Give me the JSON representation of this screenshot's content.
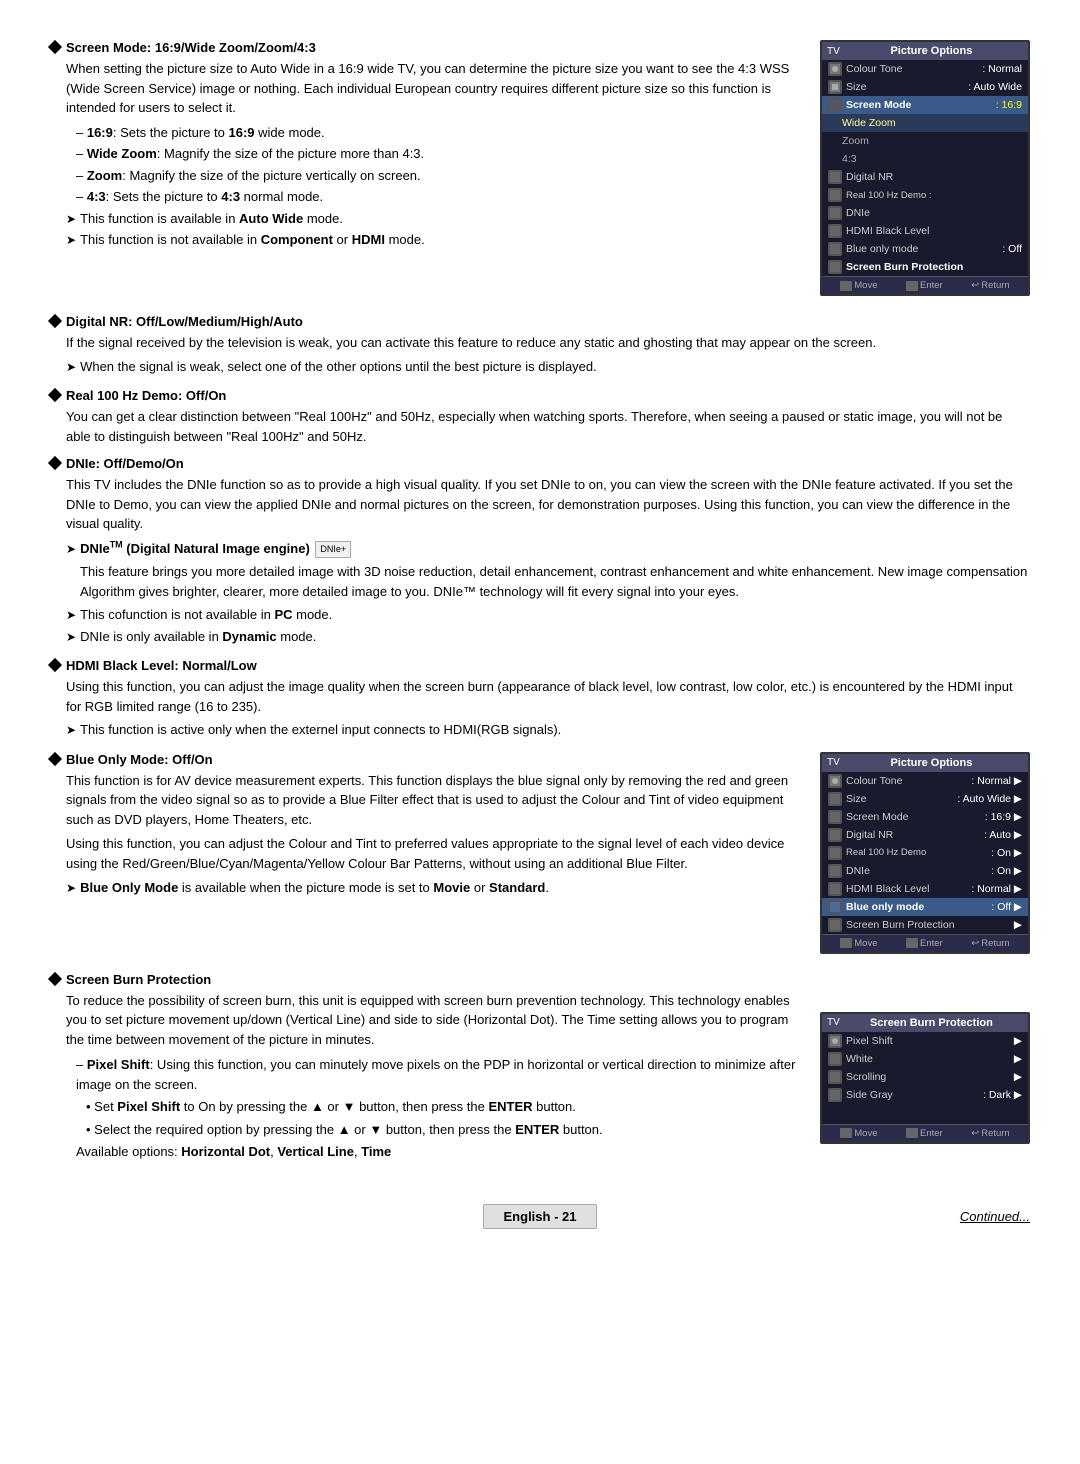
{
  "page": {
    "sections": [
      {
        "id": "screen-mode",
        "heading": "Screen Mode: 16:9/Wide Zoom/Zoom/4:3",
        "paragraphs": [
          "When setting the picture size to Auto Wide in a 16:9 wide TV, you can determine the picture size you want to see the 4:3 WSS (Wide Screen Service) image or nothing. Each individual European country requires different picture size so this function is intended for users to select it."
        ],
        "bullets": [
          "– 16:9: Sets the picture to 16:9 wide mode.",
          "– Wide Zoom: Magnify the size of the picture more than 4:3.",
          "– Zoom: Magnify the size of the picture vertically on screen.",
          "– 4:3: Sets the picture to 4:3 normal mode."
        ],
        "arrows": [
          "This function is available in Auto Wide mode.",
          "This function is not available in Component or HDMI mode."
        ],
        "has_tv": true
      },
      {
        "id": "digital-nr",
        "heading": "Digital NR: Off/Low/Medium/High/Auto",
        "paragraphs": [
          "If the signal received by the television is weak, you can activate this feature to reduce any static and ghosting that may appear on the screen."
        ],
        "arrows": [
          "When the signal is weak, select one of the other options until the best picture is displayed."
        ]
      },
      {
        "id": "real-100hz",
        "heading": "Real 100 Hz Demo: Off/On",
        "paragraphs": [
          "You can get a clear distinction between \"Real 100Hz\" and 50Hz, especially when watching sports. Therefore, when seeing a paused or static image, you will not be able to distinguish between \"Real 100Hz\" and 50Hz."
        ]
      },
      {
        "id": "dnie",
        "heading": "DNIe: Off/Demo/On",
        "paragraphs": [
          "This TV includes the DNIe function so as to provide a high visual quality. If you set DNIe to on, you can view the screen with the DNIe feature activated. If you set the DNIe to Demo, you can view the applied DNIe and normal pictures on the screen, for demonstration purposes. Using this function, you can view the difference in the visual quality."
        ],
        "sub_heading": "DNIe™ (Digital Natural Image engine)",
        "sub_heading_badge": "DNIe",
        "sub_paragraphs": [
          "This feature brings you more detailed image with 3D noise reduction, detail enhancement, contrast enhancement and white enhancement. New image compensation Algorithm gives brighter, clearer, more detailed image to you. DNIe™ technology will fit every signal into your eyes."
        ],
        "sub_arrows": [
          "This cofunction is not available in PC mode.",
          "DNIe is only available in Dynamic mode."
        ]
      },
      {
        "id": "hdmi-black",
        "heading": "HDMI Black Level: Normal/Low",
        "paragraphs": [
          "Using this function, you can adjust the image quality when the screen burn (appearance of black level, low contrast, low color, etc.) is encountered by the HDMI input for RGB limited range (16 to 235)."
        ],
        "arrows": [
          "This function is active only when the externel input connects to HDMI(RGB signals)."
        ]
      },
      {
        "id": "blue-only",
        "heading": "Blue Only Mode: Off/On",
        "paragraphs": [
          "This function is for AV device measurement experts. This function displays the blue signal only by removing the red and green signals from the video signal so as to provide a Blue Filter effect that is used to adjust the Colour and Tint of video equipment such as DVD players, Home Theaters, etc.",
          "Using this function, you can adjust the Colour and Tint to preferred values appropriate to the signal level of each video device using the Red/Green/Blue/Cyan/Magenta/Yellow Colour Bar Patterns, without using an additional Blue Filter."
        ],
        "arrows": [
          "Blue Only Mode is available when the picture mode is set to Movie or Standard."
        ],
        "has_tv2": true
      },
      {
        "id": "screen-burn",
        "heading": "Screen Burn Protection",
        "paragraphs": [
          "To reduce the possibility of screen burn, this unit is equipped with screen burn prevention technology. This technology enables you to set picture movement up/down (Vertical Line) and side to side (Horizontal Dot). The Time setting allows you to program the time between movement of the picture in minutes."
        ],
        "sub_bullets": [
          "– Pixel Shift: Using this function, you can minutely move pixels on the PDP in horizontal or vertical direction to minimize after image on the screen.",
          "• Set Pixel Shift to On by pressing the ▲ or ▼ button, then press the ENTER button.",
          "• Select the required option by pressing the ▲ or ▼ button, then press the ENTER button.",
          "Available options: Horizontal Dot, Vertical Line, Time"
        ],
        "has_tv3": true
      }
    ],
    "tv_panel_1": {
      "title_tv": "TV",
      "title_options": "Picture Options",
      "items": [
        {
          "icon": "pic",
          "label": "Colour Tone",
          "value": ": Normal",
          "highlighted": false
        },
        {
          "icon": "size",
          "label": "Size",
          "value": ": Auto Wide",
          "highlighted": false
        },
        {
          "icon": "screen",
          "label": "Screen Mode",
          "value": ": 16:9",
          "highlighted": true,
          "sub_items": [
            {
              "label": "Wide Zoom",
              "selected": true
            },
            {
              "label": "Zoom",
              "selected": false
            },
            {
              "label": "4:3",
              "selected": false
            }
          ]
        },
        {
          "icon": "dnr",
          "label": "Digital NR",
          "value": "",
          "highlighted": false
        },
        {
          "icon": "real",
          "label": "Real 100 Hz Demo",
          "value": ":",
          "highlighted": false
        },
        {
          "icon": "dnie",
          "label": "DNIe",
          "value": "",
          "highlighted": false
        },
        {
          "icon": "hdmi",
          "label": "HDMI Black Level",
          "value": "",
          "highlighted": false
        },
        {
          "icon": "blue",
          "label": "Blue only mode",
          "value": ": Off",
          "highlighted": false
        },
        {
          "icon": "burn",
          "label": "Screen Burn Protection",
          "value": "",
          "highlighted": false
        }
      ],
      "footer": [
        "Move",
        "Enter",
        "Return"
      ]
    },
    "tv_panel_2": {
      "title_tv": "TV",
      "title_options": "Picture Options",
      "items": [
        {
          "label": "Colour Tone",
          "value": ": Normal"
        },
        {
          "label": "Size",
          "value": ": Auto Wide"
        },
        {
          "label": "Screen Mode",
          "value": ": 16:9"
        },
        {
          "label": "Digital NR",
          "value": ": Auto"
        },
        {
          "label": "Real 100 Hz Demo",
          "value": ": On"
        },
        {
          "label": "DNIe",
          "value": ": On"
        },
        {
          "label": "HDMI Black Level",
          "value": ": Normal"
        },
        {
          "label": "Blue only mode",
          "value": ": Off",
          "highlighted": true
        },
        {
          "label": "Screen Burn Protection",
          "value": ""
        }
      ],
      "footer": [
        "Move",
        "Enter",
        "Return"
      ]
    },
    "tv_panel_3": {
      "title_tv": "TV",
      "title_options": "Screen Burn Protection",
      "items": [
        {
          "label": "Pixel Shift",
          "value": ""
        },
        {
          "label": "White",
          "value": ""
        },
        {
          "label": "Scrolling",
          "value": ""
        },
        {
          "label": "Side Gray",
          "value": ": Dark"
        }
      ],
      "footer": [
        "Move",
        "Enter",
        "Return"
      ]
    },
    "footer": {
      "badge": "English - 21",
      "continued": "Continued..."
    }
  }
}
